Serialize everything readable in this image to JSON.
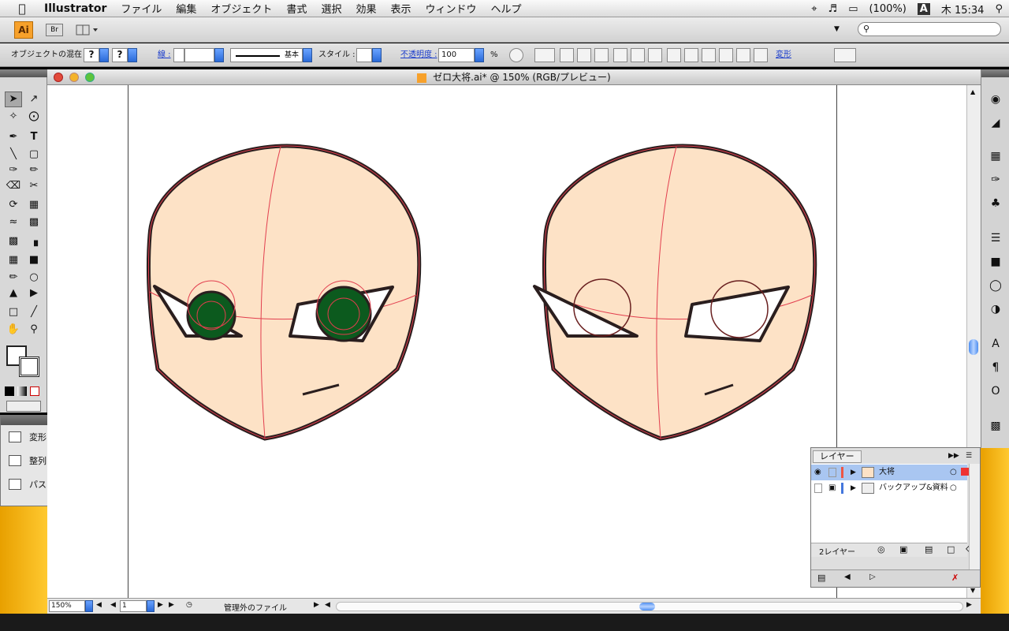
{
  "menubar": {
    "apple": "",
    "app": "Illustrator",
    "items": [
      "ファイル",
      "編集",
      "オブジェクト",
      "書式",
      "選択",
      "効果",
      "表示",
      "ウィンドウ",
      "ヘルプ"
    ],
    "battery": "(100%)",
    "input_mode": "A",
    "clock": "木 15:34"
  },
  "appbar": {
    "ai_logo": "Ai",
    "bridge": "Br"
  },
  "control": {
    "mix_label": "オブジェクトの混在",
    "q1": "?",
    "q2": "?",
    "stroke_label": "線 :",
    "stroke_style": "基本",
    "style_label": "スタイル :",
    "opacity_label": "不透明度 :",
    "opacity_value": "100",
    "percent": "%",
    "transform_link": "変形"
  },
  "document": {
    "title": "ゼロ大将.ai* @ 150% (RGB/プレビュー)"
  },
  "side_panel": {
    "items": [
      "変形",
      "整列",
      "パスファインダ"
    ]
  },
  "layers": {
    "tab": "レイヤー",
    "rows": [
      {
        "name": "大将",
        "selected": true
      },
      {
        "name": "バックアップ&資料",
        "selected": false
      }
    ],
    "count": "2レイヤー"
  },
  "status": {
    "zoom": "150%",
    "page": "1",
    "info": "管理外のファイル"
  },
  "colors": {
    "skin": "#FDE2C6",
    "eye_green": "#0C5A1E",
    "path_red": "#E23E4E",
    "outline": "#2A1E1E"
  }
}
